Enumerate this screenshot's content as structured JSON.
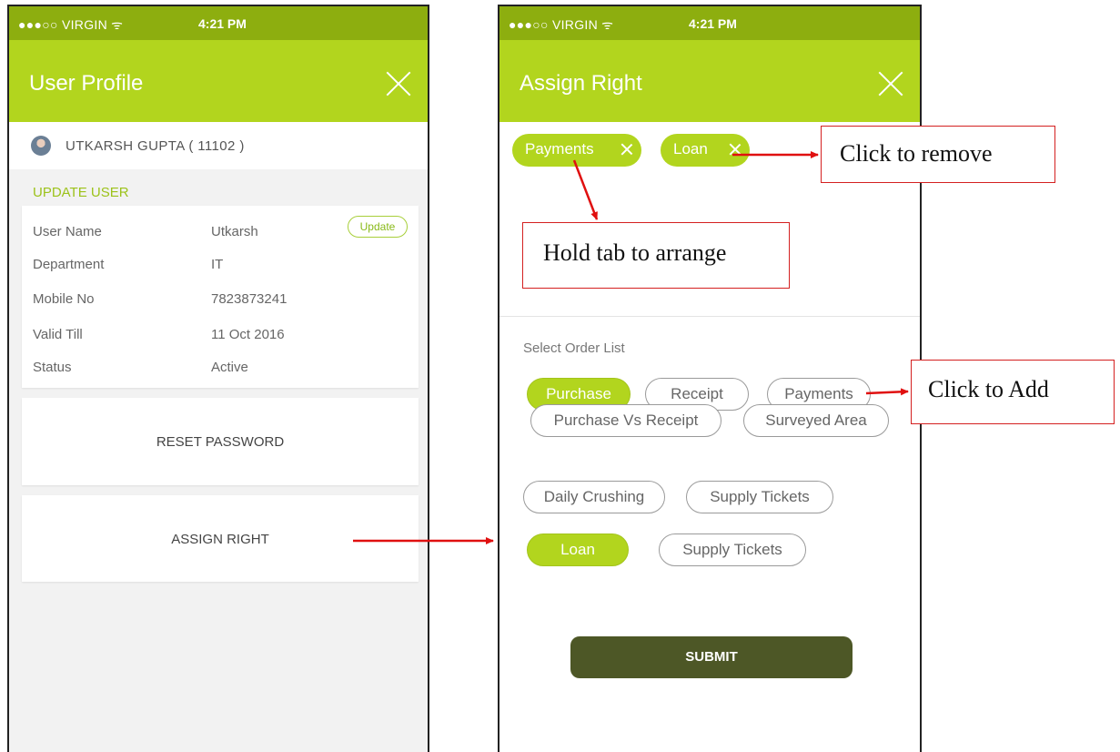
{
  "status_bar": {
    "carrier": "●●●○○ VIRGIN ᯤ",
    "time": "4:21 PM"
  },
  "user_profile": {
    "title": "User Profile",
    "user": "UTKARSH  GUPTA ( 11102 )",
    "section_title": "UPDATE USER",
    "update_label": "Update",
    "fields": [
      {
        "label": "User Name",
        "value": "Utkarsh"
      },
      {
        "label": "Department",
        "value": "IT"
      },
      {
        "label": "Mobile No",
        "value": "7823873241"
      },
      {
        "label": "Valid Till",
        "value": "11 Oct 2016"
      },
      {
        "label": "Status",
        "value": "Active"
      }
    ],
    "reset_password": "RESET PASSWORD",
    "assign_right": "ASSIGN RIGHT"
  },
  "assign_right": {
    "title": "Assign Right",
    "selected": [
      "Payments",
      "Loan"
    ],
    "select_label": "Select Order List",
    "options": [
      {
        "label": "Purchase",
        "selected": true
      },
      {
        "label": "Receipt",
        "selected": false
      },
      {
        "label": "Payments",
        "selected": false
      },
      {
        "label": "Purchase Vs Receipt",
        "selected": false
      },
      {
        "label": "Surveyed Area",
        "selected": false
      },
      {
        "label": "Daily Crushing",
        "selected": false
      },
      {
        "label": "Supply Tickets",
        "selected": false
      },
      {
        "label": "Loan",
        "selected": true
      },
      {
        "label": "Supply Tickets",
        "selected": false
      }
    ],
    "submit": "SUBMIT"
  },
  "annotations": {
    "remove": "Click to remove",
    "arrange": "Hold tab to arrange",
    "add": "Click to Add"
  },
  "colors": {
    "status_bar": "#8dae0f",
    "header": "#b2d51e",
    "submit": "#4d5726",
    "annotation": "#e01010"
  },
  "icons": {
    "close": "close-icon",
    "avatar": "avatar"
  }
}
